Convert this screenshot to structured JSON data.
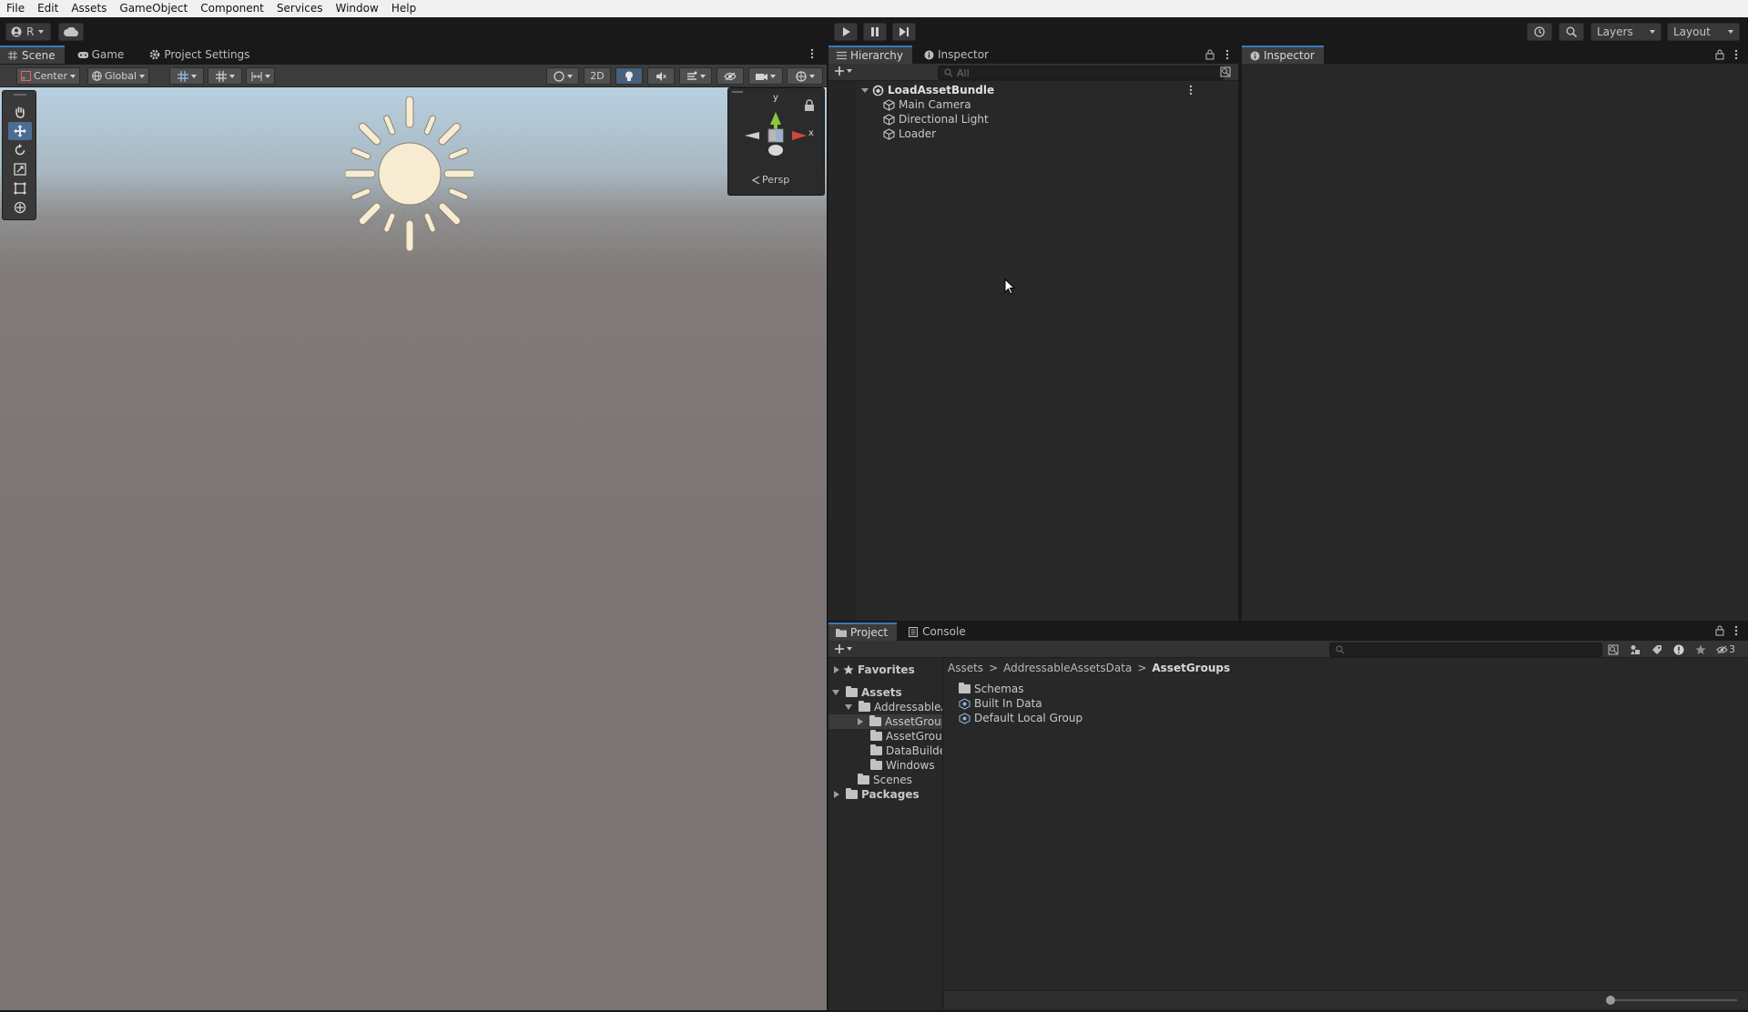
{
  "menu": [
    "File",
    "Edit",
    "Assets",
    "GameObject",
    "Component",
    "Services",
    "Window",
    "Help"
  ],
  "toolbar": {
    "account_label": "R",
    "layers_label": "Layers",
    "layout_label": "Layout"
  },
  "scene_tabs": [
    {
      "label": "Scene",
      "icon": "grid-icon"
    },
    {
      "label": "Game",
      "icon": "gamepad-icon"
    },
    {
      "label": "Project Settings",
      "icon": "gear-icon"
    }
  ],
  "scene_toolbar": {
    "pivot_label": "Center",
    "space_label": "Global",
    "mode_2d_label": "2D"
  },
  "gizmo": {
    "y_label": "y",
    "x_label": "x",
    "projection_label": "Persp"
  },
  "hierarchy_tabs": [
    {
      "label": "Hierarchy",
      "icon": "list-icon"
    },
    {
      "label": "Inspector",
      "icon": "info-icon"
    }
  ],
  "hierarchy": {
    "search_placeholder": "All",
    "scene_name": "LoadAssetBundle",
    "objects": [
      "Main Camera",
      "Directional Light",
      "Loader"
    ]
  },
  "inspector_tab": {
    "label": "Inspector",
    "icon": "info-icon"
  },
  "bottom_tabs": [
    {
      "label": "Project",
      "icon": "folder-icon"
    },
    {
      "label": "Console",
      "icon": "console-icon"
    }
  ],
  "project": {
    "hidden_count": "3",
    "favorites_label": "Favorites",
    "tree": {
      "assets_label": "Assets",
      "addressable_label": "AddressableA",
      "children": [
        "AssetGroup",
        "AssetGroup",
        "DataBuilde",
        "Windows"
      ],
      "scenes_label": "Scenes",
      "packages_label": "Packages"
    },
    "breadcrumb": [
      "Assets",
      "AddressableAssetsData",
      "AssetGroups"
    ],
    "items": [
      {
        "label": "Schemas",
        "icon": "folder-icon"
      },
      {
        "label": "Built In Data",
        "icon": "asset-group-icon"
      },
      {
        "label": "Default Local Group",
        "icon": "asset-group-icon"
      }
    ]
  },
  "colors": {
    "accent": "#3a79bb",
    "panel": "#282828",
    "tab_active": "#3c3c3c",
    "sun": "#f7ecd2"
  }
}
